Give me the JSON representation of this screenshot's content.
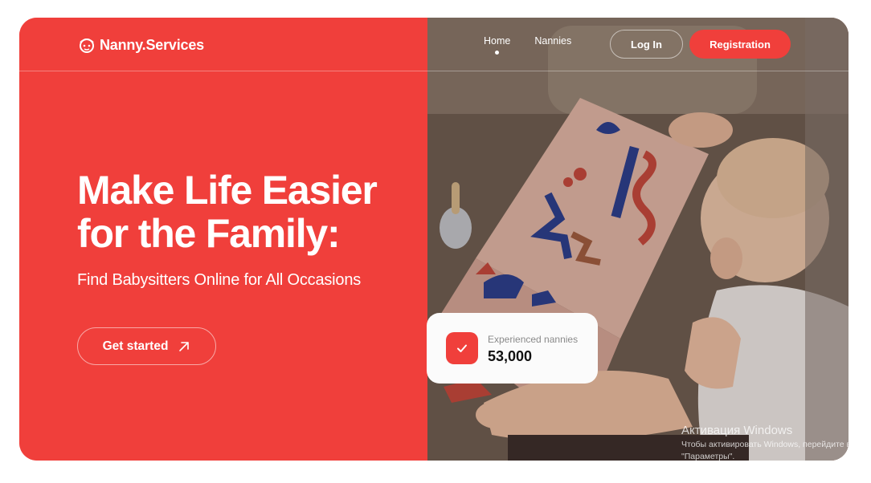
{
  "brand": {
    "name": "Nanny.Services",
    "icon": "nanny-logo-icon"
  },
  "nav": {
    "items": [
      {
        "label": "Home",
        "active": true
      },
      {
        "label": "Nannies",
        "active": false
      }
    ]
  },
  "auth": {
    "login_label": "Log In",
    "register_label": "Registration"
  },
  "hero": {
    "title_line1": "Make Life Easier",
    "title_line2": "for the Family:",
    "subtitle": "Find Babysitters Online for All Occasions",
    "cta_label": "Get started",
    "cta_icon": "arrow-up-right-icon"
  },
  "stat": {
    "label": "Experienced nannies",
    "value": "53,000",
    "icon": "check-icon"
  },
  "windows_activation": {
    "title": "Активация Windows",
    "line1": "Чтобы активировать Windows, перейдите в",
    "line2": "\"Параметры\"."
  },
  "colors": {
    "accent": "#f03f3b",
    "text_light": "#ffffff",
    "card_bg": "#fbfbfb"
  }
}
